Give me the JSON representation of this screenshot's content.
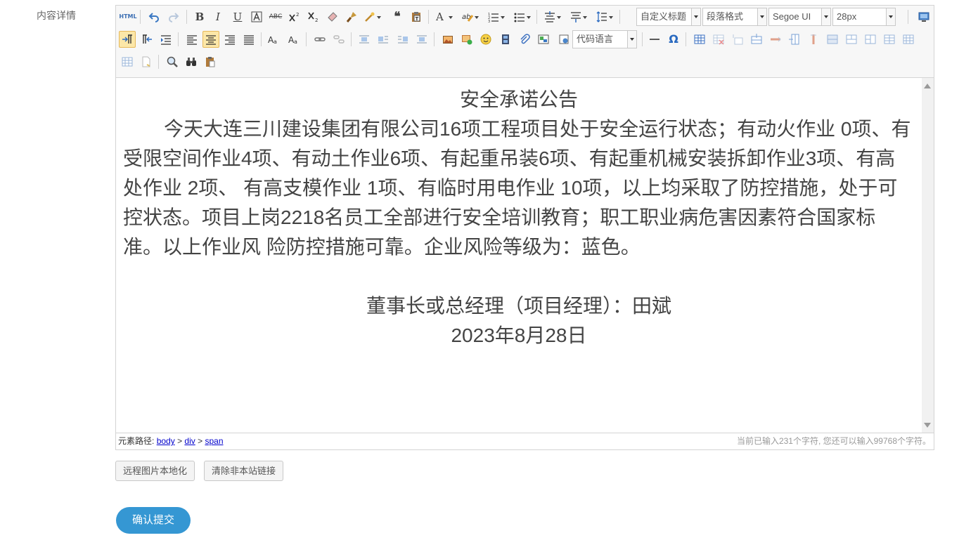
{
  "form": {
    "field_label": "内容详情",
    "remote_image_button": "远程图片本地化",
    "clear_links_button": "清除非本站链接",
    "submit_button": "确认提交"
  },
  "toolbar": {
    "html_label": "HTML",
    "bold": "B",
    "italic": "I",
    "underline": "U",
    "strike": "ABC",
    "font_color": "A",
    "heading_combo": "自定义标题",
    "paragraph_combo": "段落格式",
    "font_family_combo": "Segoe UI",
    "font_size_combo": "28px",
    "code_language_combo": "代码语言",
    "special_char": "Ω"
  },
  "content": {
    "title": "安全承诺公告",
    "paragraph": "今天大连三川建设集团有限公司16项工程项目处于安全运行状态；有动火作业 0项、有受限空间作业4项、有动土作业6项、有起重吊装6项、有起重机械安装拆卸作业3项、有高处作业 2项、 有高支模作业 1项、有临时用电作业 10项，以上均采取了防控措施，处于可控状态。项目上岗2218名员工全部进行安全培训教育；职工职业病危害因素符合国家标准。以上作业风 险防控措施可靠。企业风险等级为：蓝色。",
    "signature": "董事长或总经理（项目经理）：田斌",
    "date": "2023年8月28日"
  },
  "statusbar": {
    "path_label": "元素路径:",
    "path_body": "body",
    "path_div": "div",
    "path_span": "span",
    "path_separator": ">",
    "char_count": "当前已输入231个字符, 您还可以输入99768个字符。"
  },
  "colors": {
    "accent": "#3597d3",
    "active_button": "#fce7a8",
    "toolbar_bg": "#f7f7f7",
    "link": "#0000cc"
  }
}
